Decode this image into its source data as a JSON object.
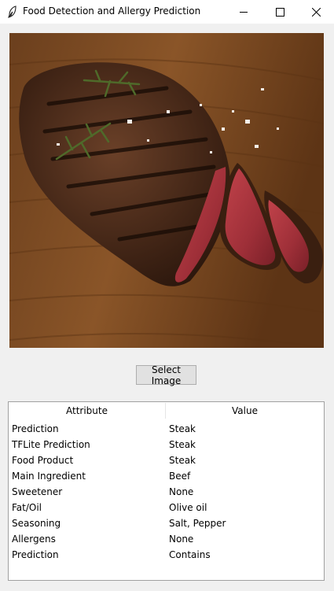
{
  "window": {
    "title": "Food Detection and Allergy Prediction"
  },
  "photo": {
    "subject": "grilled steak with rosemary on wooden board"
  },
  "select_button": {
    "label": "Select Image"
  },
  "table": {
    "columns": [
      "Attribute",
      "Value"
    ],
    "rows": [
      {
        "attribute": "Prediction",
        "value": "Steak"
      },
      {
        "attribute": "TFLite Prediction",
        "value": "Steak"
      },
      {
        "attribute": "Food Product",
        "value": "Steak"
      },
      {
        "attribute": "Main Ingredient",
        "value": "Beef"
      },
      {
        "attribute": "Sweetener",
        "value": "None"
      },
      {
        "attribute": "Fat/Oil",
        "value": "Olive oil"
      },
      {
        "attribute": "Seasoning",
        "value": "Salt, Pepper"
      },
      {
        "attribute": "Allergens",
        "value": "None"
      },
      {
        "attribute": "Prediction",
        "value": "Contains"
      }
    ]
  },
  "colors": {
    "window_bg": "#f0f0f0",
    "button_bg": "#e1e1e1",
    "table_border": "#a0a0a0"
  }
}
